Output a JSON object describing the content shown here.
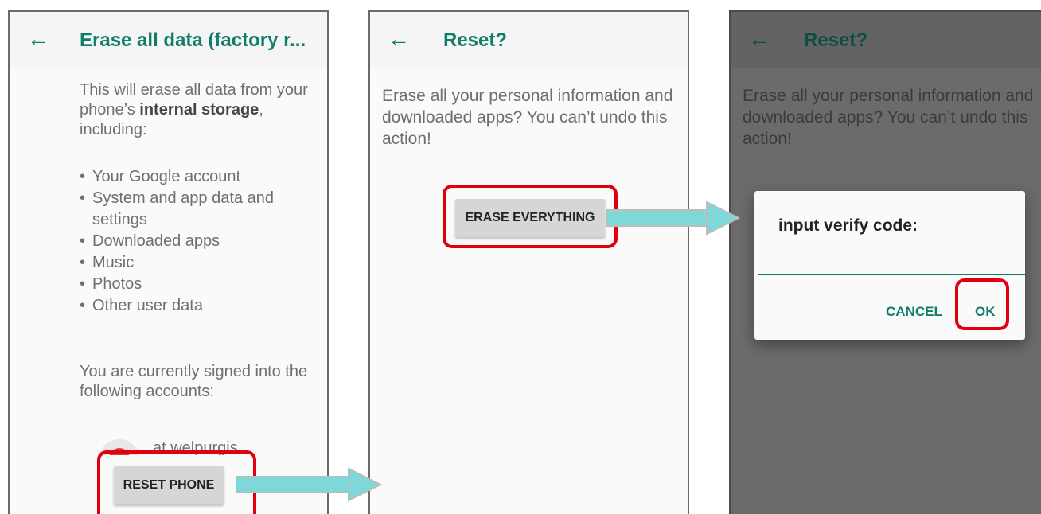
{
  "colors": {
    "accent": "#137d6c",
    "highlight": "#e0000e",
    "arrow": "#7ed8d8"
  },
  "screen1": {
    "back_icon": "arrow-back-icon",
    "title": "Erase all data (factory r...",
    "intro_part1": "This will erase all data from your phone’s ",
    "intro_bold": "internal storage",
    "intro_part2": ", including:",
    "items": [
      "Your Google account",
      "System and app data and settings",
      "Downloaded apps",
      "Music",
      "Photos",
      "Other user data"
    ],
    "signed_in_text": "You are currently signed into the following accounts:",
    "account_name": "at.welpurgis",
    "reset_button": "RESET PHONE"
  },
  "screen2": {
    "back_icon": "arrow-back-icon",
    "title": "Reset?",
    "message": "Erase all your personal information and downloaded apps? You can’t undo this action!",
    "erase_button": "ERASE EVERYTHING"
  },
  "screen3": {
    "back_icon": "arrow-back-icon",
    "title": "Reset?",
    "message": "Erase all your personal information and downloaded apps? You can’t undo this action!",
    "dialog": {
      "title": "input verify code:",
      "input_value": "",
      "cancel_label": "CANCEL",
      "ok_label": "OK"
    }
  }
}
